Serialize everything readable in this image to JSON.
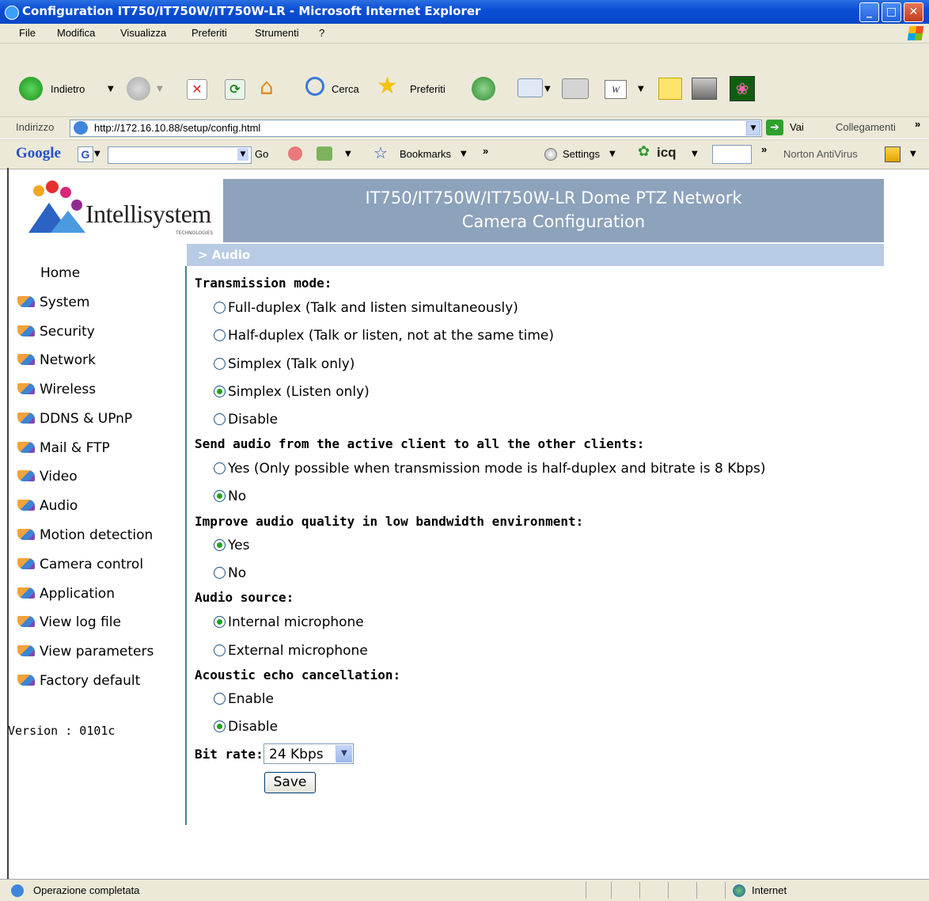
{
  "window": {
    "title": "Configuration IT750/IT750W/IT750W-LR - Microsoft Internet Explorer"
  },
  "menu": [
    "File",
    "Modifica",
    "Visualizza",
    "Preferiti",
    "Strumenti",
    "?"
  ],
  "toolbar": {
    "back_label": "Indietro",
    "search_label": "Cerca",
    "favorites_label": "Preferiti"
  },
  "address": {
    "label": "Indirizzo",
    "url": "http://172.16.10.88/setup/config.html",
    "go_label": "Vai",
    "links_label": "Collegamenti"
  },
  "googlebar": {
    "google_label": "Google",
    "go_label": "Go",
    "bookmarks_label": "Bookmarks",
    "settings_label": "Settings",
    "icq_label": "icq",
    "norton_label": "Norton AntiVirus"
  },
  "page": {
    "header_line1": "IT750/IT750W/IT750W-LR Dome PTZ Network",
    "header_line2": "Camera Configuration",
    "logo_text": "Intellisystem",
    "logo_sub": "TECHNOLOGIES",
    "section_title": "> Audio",
    "version": "Version : 0101c"
  },
  "nav": {
    "home": "Home",
    "items": [
      "System",
      "Security",
      "Network",
      "Wireless",
      "DDNS & UPnP",
      "Mail & FTP",
      "Video",
      "Audio",
      "Motion detection",
      "Camera control",
      "Application",
      "View log file",
      "View parameters",
      "Factory default"
    ]
  },
  "form": {
    "transmission_heading": "Transmission mode:",
    "transmission_options": [
      "Full-duplex (Talk and listen simultaneously)",
      "Half-duplex (Talk or listen, not at the same time)",
      "Simplex (Talk only)",
      "Simplex (Listen only)",
      "Disable"
    ],
    "transmission_selected": "Simplex (Listen only)",
    "send_heading": "Send audio from the active client to all the other clients:",
    "send_options": [
      "Yes (Only possible when transmission mode is half-duplex and bitrate is 8 Kbps)",
      "No"
    ],
    "send_selected": "No",
    "improve_heading": "Improve audio quality in low bandwidth environment:",
    "improve_options": [
      "Yes",
      "No"
    ],
    "improve_selected": "Yes",
    "source_heading": "Audio source:",
    "source_options": [
      "Internal microphone",
      "External microphone"
    ],
    "source_selected": "Internal microphone",
    "echo_heading": "Acoustic echo cancellation:",
    "echo_options": [
      "Enable",
      "Disable"
    ],
    "echo_selected": "Disable",
    "bitrate_label": "Bit rate:",
    "bitrate_value": "24 Kbps",
    "save_label": "Save"
  },
  "status": {
    "text": "Operazione completata",
    "zone": "Internet"
  }
}
